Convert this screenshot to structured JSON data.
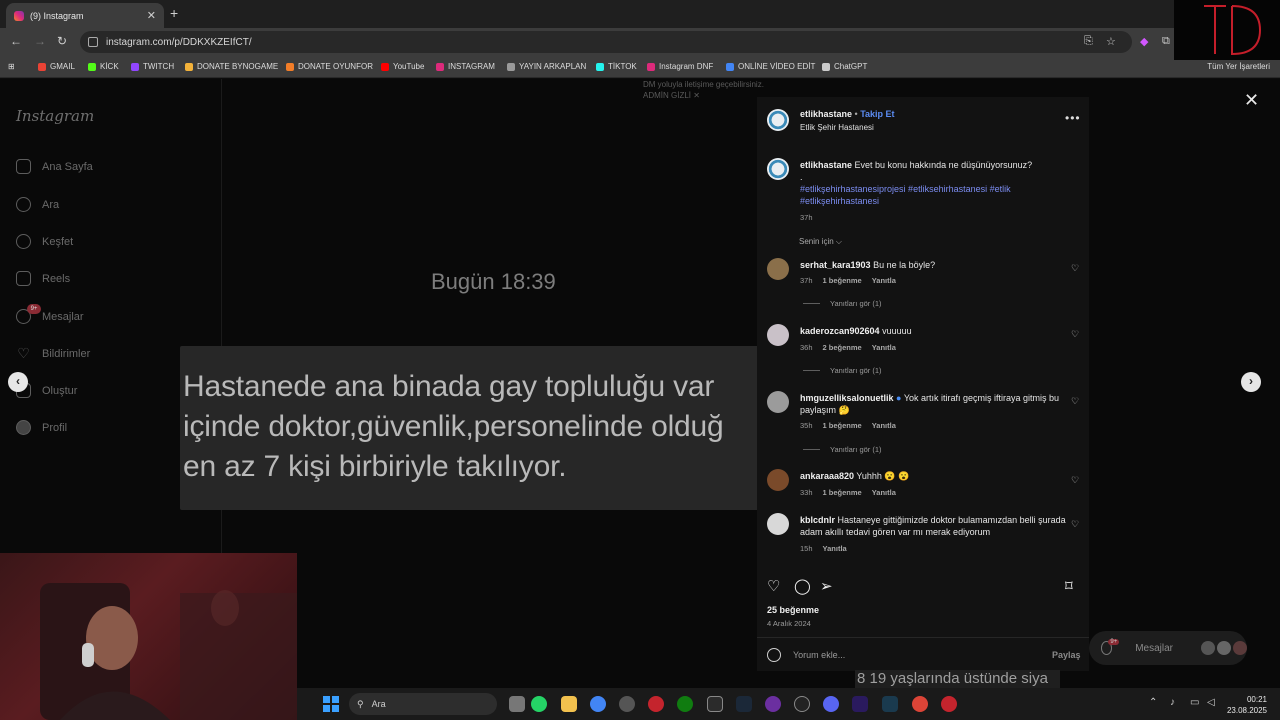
{
  "browser": {
    "tab_title": "(9) Instagram",
    "tab_close": "✕",
    "new_tab": "+",
    "url": "instagram.com/p/DDKXKZEIfCT/",
    "bookmarks": [
      {
        "label": "GMAIL",
        "color": "#ea4335"
      },
      {
        "label": "KİCK",
        "color": "#53fc18"
      },
      {
        "label": "TWITCH",
        "color": "#9146ff"
      },
      {
        "label": "DONATE BYNOGAME",
        "color": "#f3b23a"
      },
      {
        "label": "DONATE OYUNFOR",
        "color": "#f27d28"
      },
      {
        "label": "YouTube",
        "color": "#ff0000"
      },
      {
        "label": "INSTAGRAM",
        "color": "#dd2a7b"
      },
      {
        "label": "YAYIN ARKAPLAN",
        "color": "#9a9a9a"
      },
      {
        "label": "TİKTOK",
        "color": "#25f4ee"
      },
      {
        "label": "Instagram DNF",
        "color": "#dd2a7b"
      },
      {
        "label": "ONLİNE VİDEO EDİT",
        "color": "#4285f4"
      },
      {
        "label": "ChatGPT",
        "color": "#cccccc"
      }
    ],
    "all_bookmarks": "Tüm Yer İşaretleri"
  },
  "instagram": {
    "logo": "Instagram",
    "nav": [
      "Ana Sayfa",
      "Ara",
      "Keşfet",
      "Reels",
      "Mesajlar",
      "Bildirimler",
      "Oluştur",
      "Profil"
    ],
    "messages_badge": "9+",
    "top_faded_1": "DM yoluyla iletişime geçebilirsiniz.",
    "top_faded_2": "ADMİN GİZLİ ✕"
  },
  "post": {
    "time_label": "Bugün 18:39",
    "lines": [
      "Hastanede ana binada gay topluluğu var",
      "içinde doktor,güvenlik,personelinde olduğ",
      "en az 7 kişi birbiriyle takılıyor."
    ]
  },
  "panel": {
    "account": "etlikhastane",
    "follow": "Takip Et",
    "subtitle": "Etlik Şehir Hastanesi",
    "caption": {
      "user": "etlikhastane",
      "text": "Evet bu konu hakkında ne düşünüyorsunuz?",
      "dot": ".",
      "hashtags": "#etlikşehirhastanesiprojesi #etliksehirhastanesi #etlik #etlikşehirhastanesi",
      "time": "37h"
    },
    "for_you": "Senin için ⌵",
    "comments": [
      {
        "user": "serhat_kara1903",
        "text": "Bu ne la böyle?",
        "time": "37h",
        "likes": "1 beğenme",
        "reply": "Yanıtla",
        "view_replies": "Yanıtları gör (1)"
      },
      {
        "user": "kaderozcan902604",
        "text": "vuuuuu",
        "time": "36h",
        "likes": "2 beğenme",
        "reply": "Yanıtla",
        "view_replies": "Yanıtları gör (1)"
      },
      {
        "user": "hmguzelliksalonuetlik",
        "text": "Yok artık itirafı geçmiş iftiraya gitmiş bu paylaşım 🤔",
        "time": "35h",
        "likes": "1 beğenme",
        "reply": "Yanıtla",
        "view_replies": "Yanıtları gör (1)"
      },
      {
        "user": "ankaraaa820",
        "text": "Yuhhh 😮 😮",
        "time": "33h",
        "likes": "1 beğenme",
        "reply": "Yanıtla"
      },
      {
        "user": "kblcdnlr",
        "text": "Hastaneye gittiğimizde doktor bulamamızdan belli şurada adam akıllı tedavi gören var mı merak ediyorum",
        "time": "15h",
        "reply": "Yanıtla"
      }
    ],
    "likes_count": "25 beğenme",
    "date": "4 Aralık 2024",
    "comment_placeholder": "Yorum ekle...",
    "share": "Paylaş"
  },
  "messages_pill": {
    "label": "Mesajlar",
    "badge": "9+"
  },
  "subtitle_text": "8 19 yaşlarında üstünde siya",
  "taskbar": {
    "search": "Ara",
    "time": "00:21",
    "date": "23.08.2025"
  },
  "icons": {
    "back": "←",
    "forward": "→",
    "reload": "↻",
    "close": "✕",
    "left": "‹",
    "right": "›",
    "heart": "♡",
    "more": "•••",
    "bookmark": "⌑"
  }
}
